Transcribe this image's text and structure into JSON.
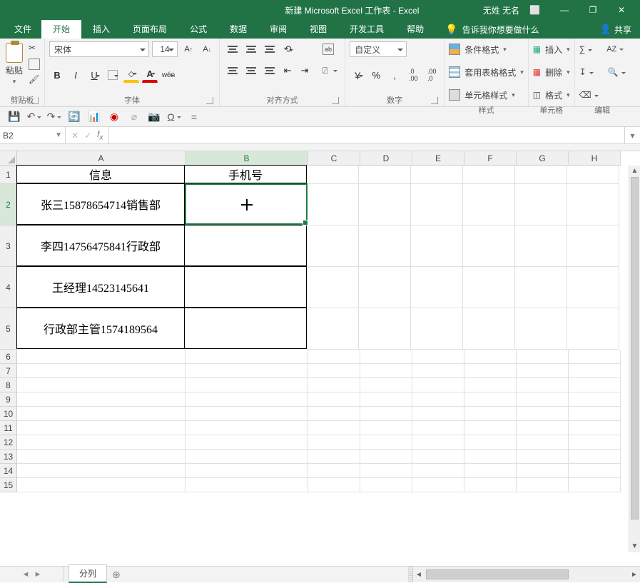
{
  "title": {
    "doc": "新建 Microsoft Excel 工作表",
    "app": "Excel",
    "user": "无姓 无名"
  },
  "window_controls": {
    "ribbon_opts": "⬜",
    "min": "—",
    "restore": "❐",
    "close": "✕"
  },
  "tabs": {
    "file": "文件",
    "items": [
      "开始",
      "插入",
      "页面布局",
      "公式",
      "数据",
      "审阅",
      "视图",
      "开发工具",
      "帮助"
    ],
    "active": "开始",
    "tell_me": "告诉我你想要做什么",
    "share": "共享"
  },
  "ribbon": {
    "clipboard": {
      "label": "剪贴板",
      "paste": "粘贴"
    },
    "font": {
      "label": "字体",
      "name": "宋体",
      "size": "14",
      "btns": {
        "bold": "B",
        "italic": "I",
        "underline": "U",
        "incfont": "A",
        "decfont": "A",
        "fontcolor": "A",
        "phonetic": "wén"
      }
    },
    "alignment": {
      "label": "对齐方式",
      "wrap": "ab",
      "merge": "⍁"
    },
    "number": {
      "label": "数字",
      "format": "自定义",
      "percent": "%",
      "comma": ",",
      "dec_inc": ".0→.00",
      "dec_dec": ".00→.0",
      "currency": "￥"
    },
    "styles": {
      "label": "样式",
      "cond": "条件格式",
      "table": "套用表格格式",
      "cell": "单元格样式"
    },
    "cells": {
      "label": "单元格",
      "insert": "插入",
      "delete": "删除",
      "format": "格式"
    },
    "editing": {
      "label": "编辑",
      "sum": "∑",
      "fill": "↧",
      "clear": "⌫",
      "sort": "A͏Z",
      "find": "🔍"
    }
  },
  "qat": {
    "items": [
      "save",
      "undo",
      "redo",
      "refresh",
      "chart-type",
      "macro-stop",
      "touch",
      "camera",
      "omega",
      "equals"
    ]
  },
  "namebox": {
    "ref": "B2"
  },
  "formula_bar": {
    "value": ""
  },
  "columns": [
    {
      "id": "A",
      "w": "wA"
    },
    {
      "id": "B",
      "w": "wB"
    },
    {
      "id": "C",
      "w": "wDef"
    },
    {
      "id": "D",
      "w": "wDef"
    },
    {
      "id": "E",
      "w": "wDef"
    },
    {
      "id": "F",
      "w": "wDef"
    },
    {
      "id": "G",
      "w": "wDef"
    },
    {
      "id": "H",
      "w": "wDef"
    }
  ],
  "rows_layout": [
    {
      "id": "1",
      "h": "hR1"
    },
    {
      "id": "2",
      "h": "hRbig"
    },
    {
      "id": "3",
      "h": "hRbig"
    },
    {
      "id": "4",
      "h": "hRbig"
    },
    {
      "id": "5",
      "h": "hRbig"
    },
    {
      "id": "6",
      "h": "hDef"
    },
    {
      "id": "7",
      "h": "hDef"
    },
    {
      "id": "8",
      "h": "hDef"
    },
    {
      "id": "9",
      "h": "hDef"
    },
    {
      "id": "10",
      "h": "hDef"
    },
    {
      "id": "11",
      "h": "hDef"
    },
    {
      "id": "12",
      "h": "hDef"
    },
    {
      "id": "13",
      "h": "hDef"
    },
    {
      "id": "14",
      "h": "hDef"
    },
    {
      "id": "15",
      "h": "hDef"
    }
  ],
  "bordered_range": {
    "r1": 1,
    "r2": 5,
    "c1": "A",
    "c2": "B"
  },
  "selection": {
    "cell": "B2"
  },
  "cells": {
    "A1": "信息",
    "B1": "手机号",
    "A2": "张三15878654714销售部",
    "A3": "李四14756475841行政部",
    "A4": "王经理14523145641",
    "A5": "行政部主管1574189564"
  },
  "sheet": {
    "active": "分列",
    "tabs": [
      "分列"
    ]
  }
}
